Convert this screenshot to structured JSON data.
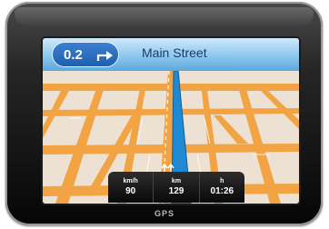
{
  "nav": {
    "distance": "0.2",
    "street": "Main Street"
  },
  "stats": [
    {
      "unit": "km/h",
      "value": "90"
    },
    {
      "unit": "km",
      "value": "129"
    },
    {
      "unit": "h",
      "value": "01:26"
    }
  ],
  "device": {
    "brand": "GPS"
  },
  "colors": {
    "road": "#f2a343",
    "route": "#1f8ad3",
    "ground": "#ece1d3",
    "header": "#8cc7ee"
  }
}
